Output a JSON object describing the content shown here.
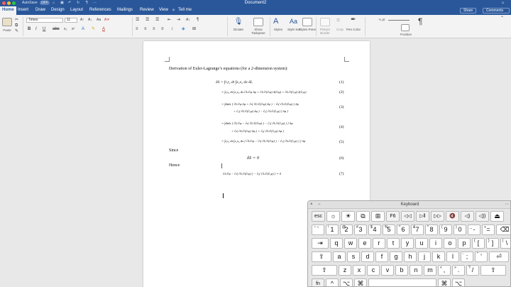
{
  "titlebar": {
    "autosave_label": "AutoSave",
    "autosave_state": "OFF",
    "document_title": "Document2"
  },
  "tabs": [
    "Home",
    "Insert",
    "Draw",
    "Design",
    "Layout",
    "References",
    "Mailings",
    "Review",
    "View",
    "Tell me"
  ],
  "tab_buttons": {
    "share": "Share",
    "comments": "Comments"
  },
  "ribbon": {
    "paste_label": "Paste",
    "font_name": "Times",
    "font_size": "11",
    "dictate_label": "Dictate",
    "show_taskpane_label": "Show Taskpane",
    "styles_label": "Styles",
    "style_set_label": "Style Set",
    "styles_pane_label": "Styles Pane",
    "picture_border_label": "Picture Border",
    "crop_label": "Crop",
    "pen_color_label": "Pen Color",
    "position_label": "Position",
    "size_value": "¾ pt"
  },
  "document": {
    "heading": "Derivation of Euler-Lagrange’s equations (for a 2-dimension system):",
    "equations": [
      {
        "text": "δS = ∫t₁t₂ dt ∫x₁x₂ dx δL",
        "num": "(1)"
      },
      {
        "text": "= ∫t₁t₂ dt ∫x₁x₂ dx  ∂L/∂φ δφ + ∂L/∂(∂ₜφ) δ(∂ₜφ) + ∂L/∂(∂ₓφ) δ(∂ₓφ)",
        "num": "(2)"
      },
      {
        "text": "= ∫dtdx [ ∂L/∂φ δφ + ∂ₜ( ∂L/∂(∂ₜφ) δφ ) − ∂ₜ( ∂L/∂(∂ₜφ) ) δφ",
        "num": "(3)"
      },
      {
        "text": "+ ∂ₓ( ∂L/∂(∂ₓφ) δφ ) − ∂ₓ( ∂L/∂(∂ₓφ) ) δφ ]",
        "num": ""
      },
      {
        "text": "= ∫dtdx [ ∂L/∂φ − ∂ₜ( ∂L/∂(∂ₜφ) ) − ∂ₓ( ∂L/∂(∂ₓφ) ) ] δφ",
        "num": "(4)"
      },
      {
        "text": "+ ∂ₜ( ∂L/∂(∂ₜφ) δφ ) + ∂ₓ( ∂L/∂(∂ₓφ) δφ )",
        "num": ""
      },
      {
        "text": "= ∫t₁t₂ dt ∫x₁x₂ dx [ ∂L/∂φ − ∂ₜ( ∂L/∂(∂ₜφ) ) − ∂ₓ( ∂L/∂(∂ₓφ) ) ] δφ",
        "num": "(5)"
      }
    ],
    "since_label": "Since",
    "since_eq": "δS = 0",
    "since_num": "(6)",
    "hence_label": "Hence",
    "hence_eq": "∂L/∂φ − ∂ₜ( ∂L/∂(∂ₜφ) ) − ∂ₓ( ∂L/∂(∂ₓφ) ) = 0",
    "hence_num": "(7)"
  },
  "keyboard": {
    "title": "Keyboard",
    "row_fn": [
      "esc",
      "☼",
      "☀",
      "⧉",
      "⊞",
      "F6",
      "◁◁",
      "▷‖",
      "▷▷",
      "🔇",
      "◁)",
      "◁))",
      "⏏"
    ],
    "row_num": [
      "~\n`",
      "!\n1",
      "@\n2",
      "#\n3",
      "$\n4",
      "%\n5",
      "^\n6",
      "&\n7",
      "*\n8",
      "(\n9",
      ")\n0",
      "_\n-",
      "+\n=",
      "⌫"
    ],
    "row_q": [
      "⇥",
      "q",
      "w",
      "e",
      "r",
      "t",
      "y",
      "u",
      "i",
      "o",
      "p",
      "{\n[",
      "}\n]",
      "|\n\\"
    ],
    "row_a": [
      "⇪",
      "a",
      "s",
      "d",
      "f",
      "g",
      "h",
      "j",
      "k",
      "l",
      ":\n;",
      "\"\n'",
      "⏎"
    ],
    "row_z": [
      "⇧",
      "z",
      "x",
      "c",
      "v",
      "b",
      "n",
      "m",
      "<\n,",
      ">\n.",
      "?\n/",
      "⇧"
    ],
    "row_bottom": [
      "fn",
      "^",
      "⌥",
      "⌘",
      "",
      "⌘",
      "⌥"
    ]
  }
}
